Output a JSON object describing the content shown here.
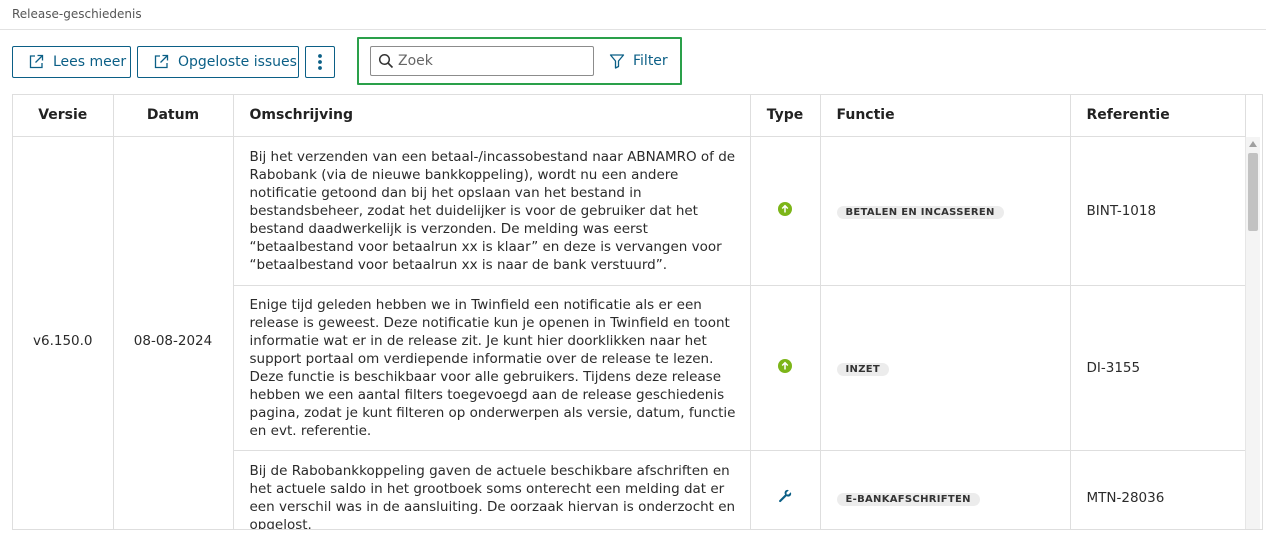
{
  "header": {
    "title": "Release-geschiedenis"
  },
  "toolbar": {
    "lees_meer_label": "Lees meer",
    "opgeloste_issues_label": "Opgeloste issues",
    "more_icon": "vertical-ellipsis-icon"
  },
  "search": {
    "placeholder": "Zoek",
    "value": "",
    "filter_label": "Filter"
  },
  "colors": {
    "accent": "#0b5f86",
    "highlight_border": "#2aa04a",
    "improvement_icon": "#7cb518",
    "tag_bg": "#ececec"
  },
  "table": {
    "columns": [
      "Versie",
      "Datum",
      "Omschrijving",
      "Type",
      "Functie",
      "Referentie"
    ],
    "version": "v6.150.0",
    "date": "08-08-2024",
    "rows": [
      {
        "description": "Bij het verzenden van een betaal-/incassobestand naar ABNAMRO of de Rabobank (via de nieuwe bankkoppeling), wordt nu een andere notificatie getoond dan bij het opslaan van het bestand in bestandsbeheer, zodat het duidelijker is voor de gebruiker dat het bestand daadwerkelijk is verzonden. De melding was eerst “betaalbestand voor betaalrun xx is klaar” en deze is vervangen voor “betaalbestand voor betaalrun xx is naar de bank verstuurd”.",
        "type_icon": "arrow-up-circle-icon",
        "function": "BETALEN EN INCASSEREN",
        "reference": "BINT-1018"
      },
      {
        "description": "Enige tijd geleden hebben we in Twinfield een notificatie als er een release is geweest. Deze notificatie kun je openen in Twinfield en toont informatie wat er in de release zit. Je kunt hier doorklikken naar het support portaal om verdiepende informatie over de release te lezen. Deze functie is beschikbaar voor alle gebruikers. Tijdens deze release hebben we een aantal filters toegevoegd aan de release geschiedenis pagina, zodat je kunt filteren op onderwerpen als versie, datum, functie en evt. referentie.",
        "type_icon": "arrow-up-circle-icon",
        "function": "INZET",
        "reference": "DI-3155"
      },
      {
        "description": "Bij de Rabobankkoppeling gaven de actuele beschikbare afschriften en het actuele saldo in het grootboek soms onterecht een melding dat er een verschil was in de aansluiting. De oorzaak hiervan is onderzocht en opgelost.",
        "type_icon": "wrench-icon",
        "function": "E-BANKAFSCHRIFTEN",
        "reference": "MTN-28036"
      }
    ]
  }
}
